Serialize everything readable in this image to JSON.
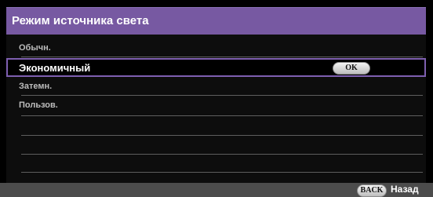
{
  "menu": {
    "title": "Режим источника света",
    "items": [
      {
        "label": "Обычн.",
        "selected": false
      },
      {
        "label": "Экономичный",
        "selected": true
      },
      {
        "label": "Затемн.",
        "selected": false
      },
      {
        "label": "Пользов.",
        "selected": false
      }
    ],
    "confirm_key": "OK"
  },
  "footer": {
    "back_key": "BACK",
    "back_label": "Назад"
  },
  "colors": {
    "title_bar": "#7759a2",
    "selection_border": "#7e5fb0",
    "footer_bar": "#4c4c4c",
    "background": "#000000"
  },
  "icons": {
    "ok": "ok-key-icon",
    "back": "back-key-icon"
  }
}
